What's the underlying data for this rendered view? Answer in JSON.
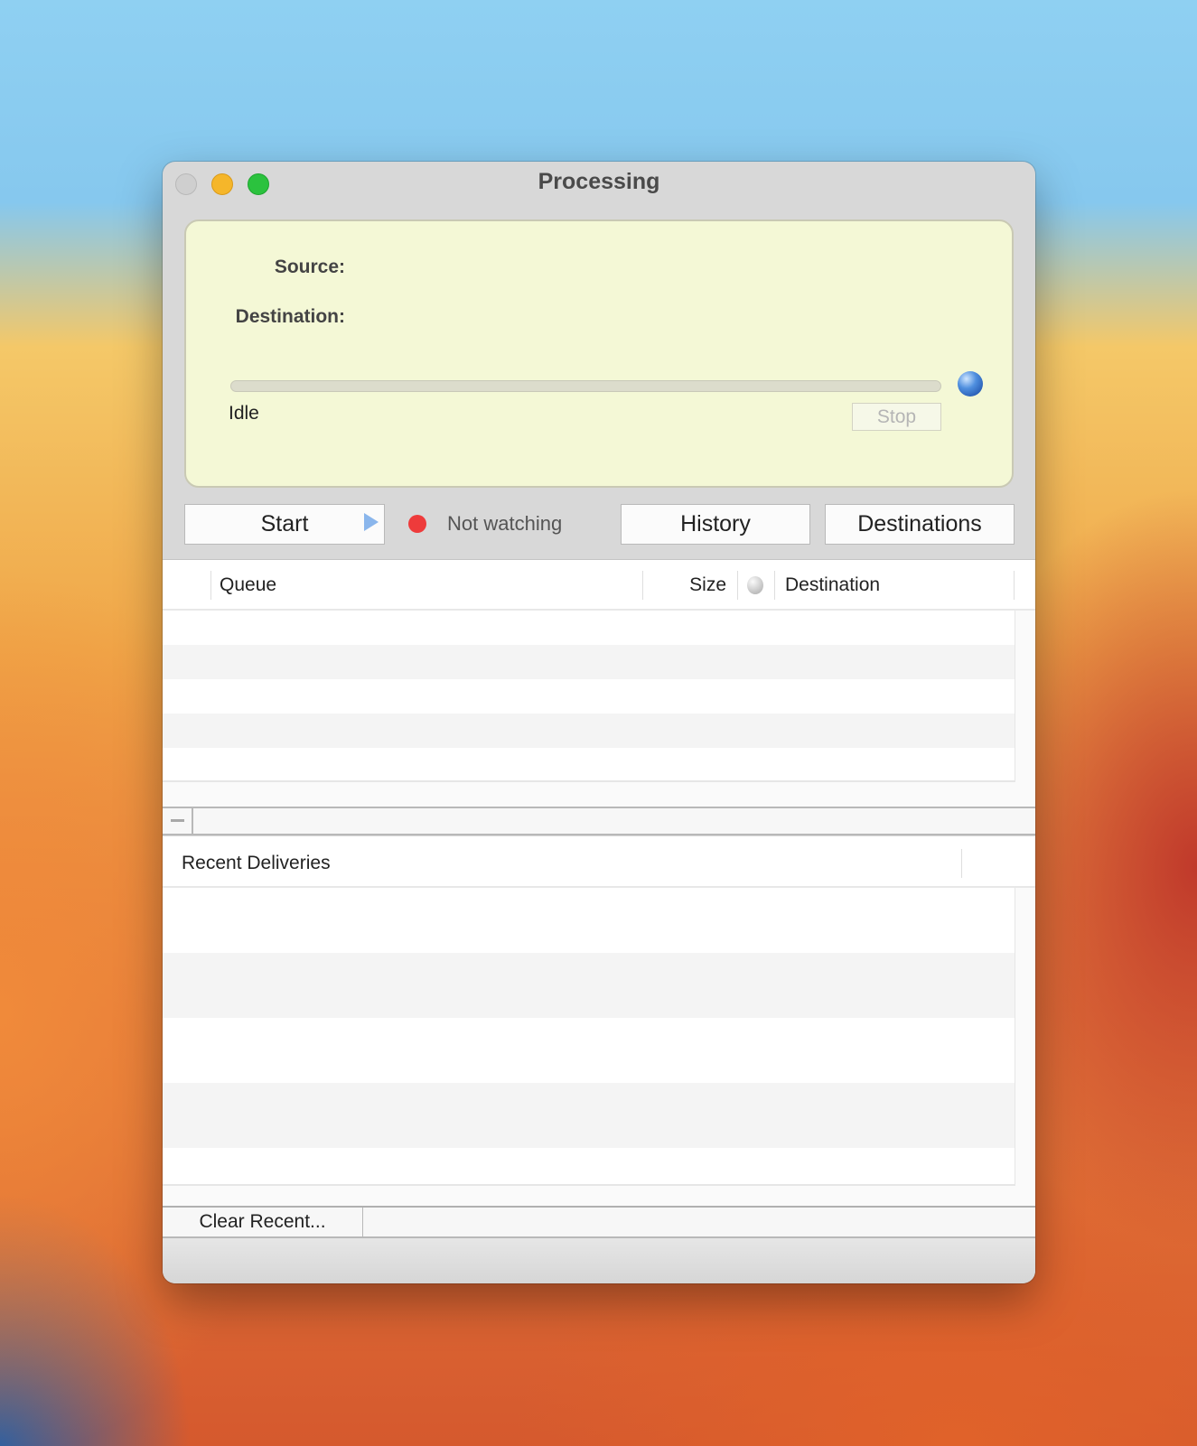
{
  "window": {
    "title": "Processing"
  },
  "status_panel": {
    "source_label": "Source:",
    "destination_label": "Destination:",
    "status_text": "Idle",
    "stop_label": "Stop",
    "progress": 0
  },
  "toolbar": {
    "start_label": "Start",
    "watch_status": "Not watching",
    "history_label": "History",
    "destinations_label": "Destinations"
  },
  "queue_table": {
    "columns": [
      "Queue",
      "Size",
      "Destination"
    ],
    "rows": []
  },
  "recent_table": {
    "columns": [
      "Recent Deliveries"
    ],
    "rows": []
  },
  "bottom_bar": {
    "clear_recent_label": "Clear Recent..."
  },
  "colors": {
    "panel_bg": "#f4f8d6",
    "watch_indicator": "#ee3b3b",
    "close": "#cfcfcf",
    "minimize": "#f5b62a",
    "zoom": "#2bc23e"
  }
}
